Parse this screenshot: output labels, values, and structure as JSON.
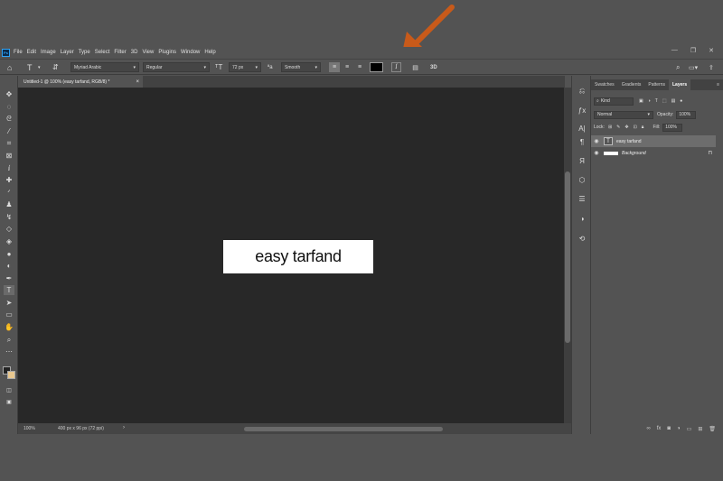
{
  "app": {
    "logo_text": "Ps"
  },
  "menu": [
    "File",
    "Edit",
    "Image",
    "Layer",
    "Type",
    "Select",
    "Filter",
    "3D",
    "View",
    "Plugins",
    "Window",
    "Help"
  ],
  "window_controls": {
    "minimize": "—",
    "restore": "❐",
    "close": "✕"
  },
  "options_bar": {
    "font_family": "Myriad Arabic",
    "font_style": "Regular",
    "font_size": "72 px",
    "antialias": "Smooth",
    "text_color": "#000000",
    "three_d": "3D"
  },
  "document": {
    "tab_title": "Untitled-1 @ 100% (easy tarfand, RGB/8) *",
    "canvas_text": "easy tarfand",
    "zoom": "100%",
    "doc_info": "400 px x 96 px (72 ppi)"
  },
  "layers_panel": {
    "tabs": [
      "Swatches",
      "Gradients",
      "Patterns",
      "Layers"
    ],
    "active_tab": "Layers",
    "filter_kind": "Kind",
    "blend_mode": "Normal",
    "opacity_label": "Opacity:",
    "opacity": "100%",
    "lock_label": "Lock:",
    "fill_label": "Fill:",
    "fill": "100%",
    "layers": [
      {
        "name": "easy tarfand",
        "type": "text",
        "selected": true
      },
      {
        "name": "Background",
        "type": "background",
        "selected": false
      }
    ]
  },
  "colors": {
    "ui_bg": "#535353",
    "canvas_bg": "#282828",
    "accent_arrow": "#c85a1a"
  }
}
